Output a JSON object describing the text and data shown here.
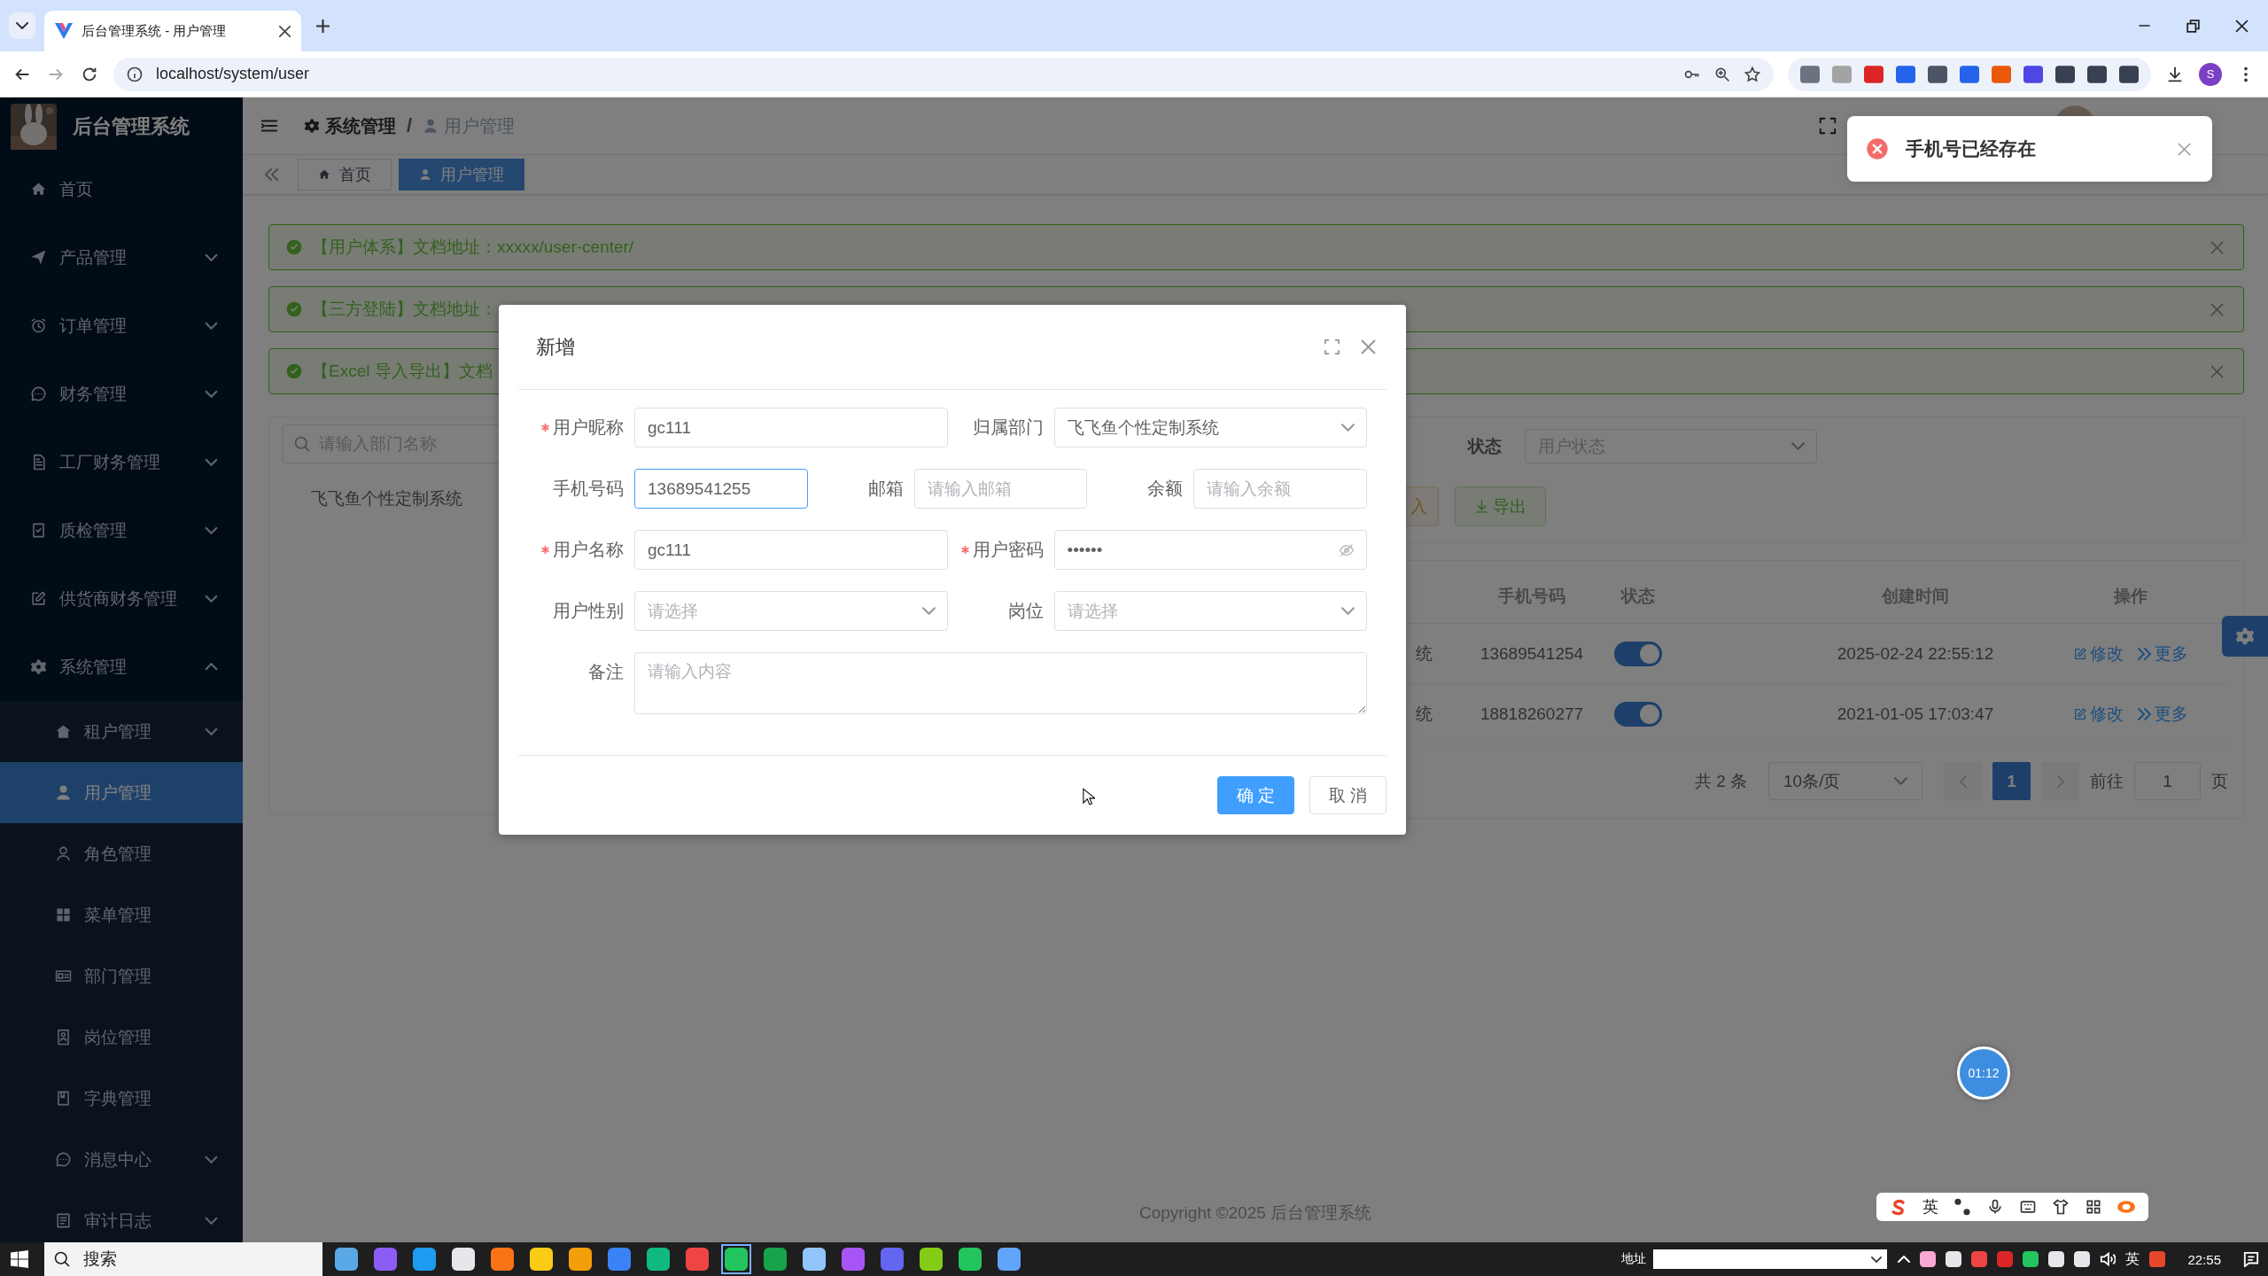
{
  "browser": {
    "tab_title": "后台管理系统 - 用户管理",
    "url": "localhost/system/user",
    "profile_initial": "S"
  },
  "sidebar": {
    "title": "后台管理系统",
    "items": [
      {
        "label": "首页",
        "kind": "link",
        "selected": false
      },
      {
        "label": "产品管理",
        "kind": "group",
        "expanded": false,
        "selected": false
      },
      {
        "label": "订单管理",
        "kind": "group",
        "expanded": false,
        "selected": false
      },
      {
        "label": "财务管理",
        "kind": "group",
        "expanded": false,
        "selected": false
      },
      {
        "label": "工厂财务管理",
        "kind": "group",
        "expanded": false,
        "selected": false
      },
      {
        "label": "质检管理",
        "kind": "group",
        "expanded": false,
        "selected": false
      },
      {
        "label": "供货商财务管理",
        "kind": "group",
        "expanded": false,
        "selected": false
      },
      {
        "label": "系统管理",
        "kind": "group",
        "expanded": true,
        "selected": false,
        "children": [
          {
            "label": "租户管理",
            "kind": "group",
            "expanded": false,
            "selected": false
          },
          {
            "label": "用户管理",
            "kind": "link",
            "selected": true
          },
          {
            "label": "角色管理",
            "kind": "link",
            "selected": false
          },
          {
            "label": "菜单管理",
            "kind": "link",
            "selected": false
          },
          {
            "label": "部门管理",
            "kind": "link",
            "selected": false
          },
          {
            "label": "岗位管理",
            "kind": "link",
            "selected": false
          },
          {
            "label": "字典管理",
            "kind": "link",
            "selected": false
          },
          {
            "label": "消息中心",
            "kind": "group",
            "expanded": false,
            "selected": false
          },
          {
            "label": "审计日志",
            "kind": "group",
            "expanded": false,
            "selected": false
          }
        ]
      }
    ]
  },
  "navbar": {
    "breadcrumb": [
      "系统管理",
      "用户管理"
    ],
    "separator": "/"
  },
  "tags": [
    {
      "label": "首页",
      "selected": false
    },
    {
      "label": "用户管理",
      "selected": true
    }
  ],
  "alerts": [
    {
      "text": "【用户体系】文档地址：xxxxx/user-center/"
    },
    {
      "text": "【三方登陆】文档地址："
    },
    {
      "text": "【Excel 导入导出】文档"
    }
  ],
  "dept_tree": {
    "search_placeholder": "请输入部门名称",
    "nodes": [
      {
        "label": "飞飞鱼个性定制系统"
      }
    ]
  },
  "query": {
    "status_label": "状态",
    "status_placeholder": "用户状态",
    "buttons": [
      {
        "label": "入",
        "kind": "import"
      },
      {
        "label": "导出",
        "kind": "export"
      }
    ]
  },
  "table": {
    "columns": [
      "手机号码",
      "状态",
      "创建时间",
      "操作"
    ],
    "rows": [
      {
        "dept": "统",
        "phone": "13689541254",
        "enabled": true,
        "created": "2025-02-24 22:55:12",
        "actions": [
          "修改",
          "更多"
        ]
      },
      {
        "dept": "统",
        "phone": "18818260277",
        "enabled": true,
        "created": "2021-01-05 17:03:47",
        "actions": [
          "修改",
          "更多"
        ]
      }
    ]
  },
  "pagination": {
    "total": "共 2 条",
    "page_size": "10条/页",
    "pages": [
      {
        "label": "1",
        "selected": true
      }
    ],
    "goto_label": "前往",
    "goto_value": "1",
    "page_suffix": "页"
  },
  "dialog": {
    "title": "新增",
    "rows": [
      [
        {
          "label": "用户昵称",
          "required": true,
          "kind": "input",
          "value": "gc111",
          "focused": false
        },
        {
          "label": "归属部门",
          "required": false,
          "kind": "select",
          "value": "飞飞鱼个性定制系统",
          "focused": false
        }
      ],
      [
        {
          "label": "手机号码",
          "required": false,
          "kind": "input",
          "value": "13689541255",
          "focused": true
        },
        {
          "label": "邮箱",
          "required": false,
          "kind": "input",
          "placeholder": "请输入邮箱",
          "focused": false
        },
        {
          "label": "余额",
          "required": false,
          "kind": "input",
          "placeholder": "请输入余额",
          "focused": false
        }
      ],
      [
        {
          "label": "用户名称",
          "required": true,
          "kind": "input",
          "value": "gc111",
          "focused": false
        },
        {
          "label": "用户密码",
          "required": true,
          "kind": "password",
          "value": "••••••",
          "focused": false
        }
      ],
      [
        {
          "label": "用户性别",
          "required": false,
          "kind": "select",
          "placeholder": "请选择",
          "focused": false
        },
        {
          "label": "岗位",
          "required": false,
          "kind": "select",
          "placeholder": "请选择",
          "focused": false
        }
      ],
      [
        {
          "label": "备注",
          "required": false,
          "kind": "textarea",
          "placeholder": "请输入内容",
          "focused": false
        }
      ]
    ],
    "buttons": [
      {
        "label": "确 定",
        "kind": "primary"
      },
      {
        "label": "取 消",
        "kind": "default"
      }
    ]
  },
  "toast": {
    "message": "手机号已经存在",
    "kind": "error"
  },
  "timer": "01:12",
  "footer": "Copyright ©2025 后台管理系统",
  "ime_toolbar": {
    "mode": "英"
  },
  "taskbar": {
    "search_placeholder": "搜索",
    "address_label": "地址",
    "ime": "英",
    "clock": "22:55"
  }
}
